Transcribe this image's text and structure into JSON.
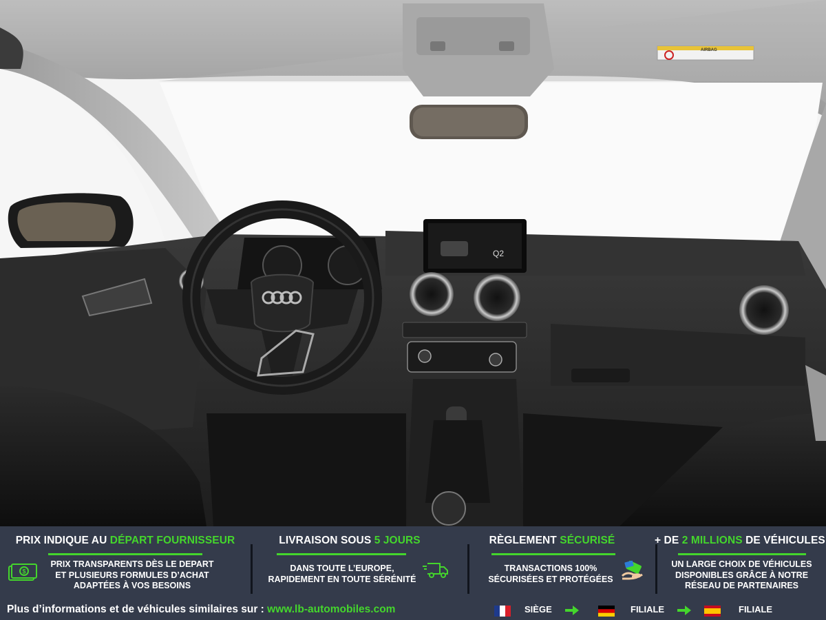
{
  "photo": {
    "alt": "",
    "dash_screen_model": "Q2",
    "airbag_label": "AIRBAG"
  },
  "banner": {
    "columns": [
      {
        "title_pre": "PRIX INDIQUE AU ",
        "title_hl": "DÉPART FOURNISSEUR",
        "title_post": "",
        "lines": [
          "PRIX TRANSPARENTS DÈS LE DEPART",
          "ET PLUSIEURS FORMULES D’ACHAT",
          "ADAPTÉES À VOS BESOINS"
        ],
        "icon": "money-icon"
      },
      {
        "title_pre": "LIVRAISON SOUS ",
        "title_hl": "5 JOURS",
        "title_post": "",
        "lines": [
          "DANS TOUTE L’EUROPE,",
          "RAPIDEMENT EN TOUTE SÉRÉNITÉ"
        ],
        "icon": "delivery-truck-icon"
      },
      {
        "title_pre": "RÈGLEMENT ",
        "title_hl": "SÉCURISÉ",
        "title_post": "",
        "lines": [
          "TRANSACTIONS 100%",
          "SÉCURISÉES ET PROTÉGÉES"
        ],
        "icon": "secure-payment-icon"
      },
      {
        "title_pre": "+ DE ",
        "title_hl": "2 MILLIONS",
        "title_post": " DE VÉHICULES",
        "lines": [
          "UN LARGE CHOIX DE VÉHICULES",
          "DISPONIBLES GRÂCE À NOTRE",
          "RÉSEAU DE PARTENAIRES"
        ],
        "icon": ""
      }
    ],
    "footer": {
      "text": "Plus d’informations et de véhicules similaires sur : ",
      "url": "www.lb-automobiles.com",
      "locations": [
        {
          "flag": "france-flag-icon",
          "label": "SIÈGE"
        },
        {
          "flag": "germany-flag-icon",
          "label": "FILIALE"
        },
        {
          "flag": "spain-flag-icon",
          "label": "FILIALE"
        }
      ]
    },
    "colors": {
      "background": "#343b4b",
      "accent": "#44d62c",
      "text": "#ffffff"
    }
  }
}
